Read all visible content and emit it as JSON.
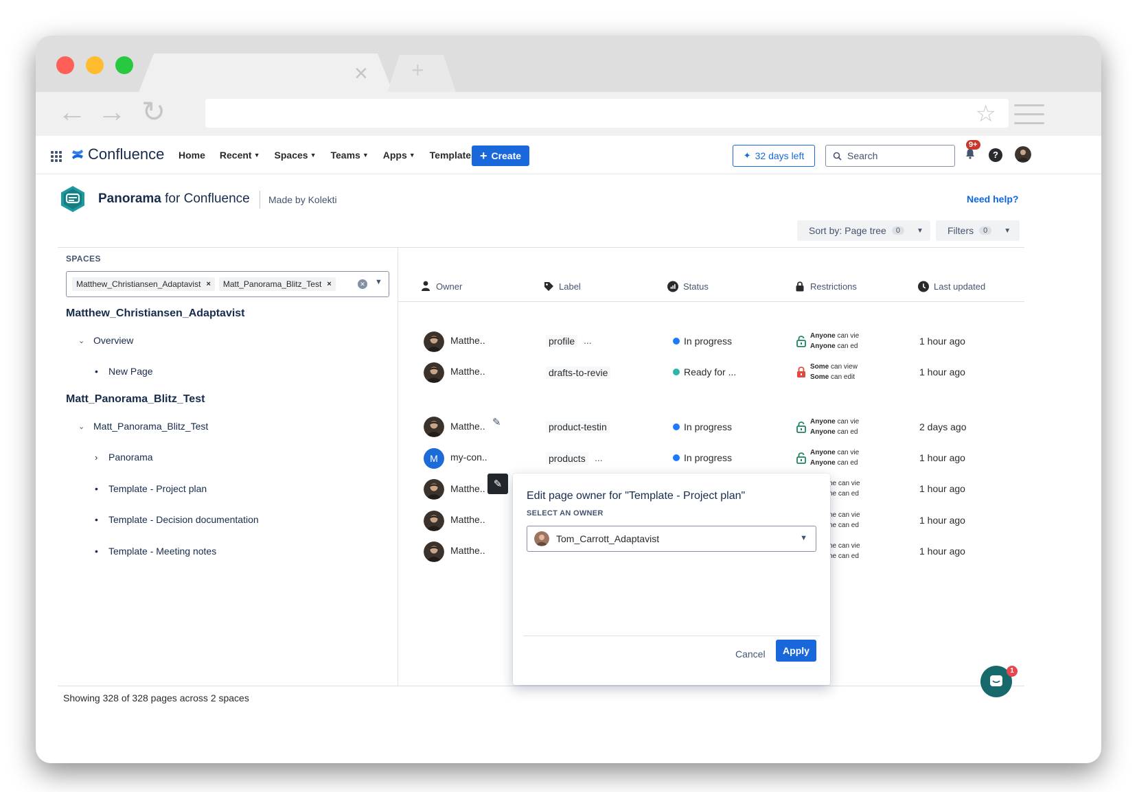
{
  "browser": {
    "tab_close": "×",
    "new_tab": "+",
    "back": "←",
    "forward": "→",
    "reload": "↻",
    "bookmark": "☆"
  },
  "topbar": {
    "product": "Confluence",
    "nav": [
      {
        "label": "Home",
        "has_dropdown": false
      },
      {
        "label": "Recent",
        "has_dropdown": true
      },
      {
        "label": "Spaces",
        "has_dropdown": true
      },
      {
        "label": "Teams",
        "has_dropdown": true
      },
      {
        "label": "Apps",
        "has_dropdown": true
      },
      {
        "label": "Templates",
        "has_dropdown": false
      }
    ],
    "create_label": "Create",
    "trial_label": "32 days left",
    "search_placeholder": "Search",
    "notifications_badge": "9+",
    "help_glyph": "?",
    "accent": "#1868db"
  },
  "app": {
    "name_bold": "Panorama",
    "name_rest": " for Confluence",
    "made_by": "Made by Kolekti",
    "need_help": "Need help?",
    "sort_label": "Sort by: Page tree",
    "sort_count": "0",
    "filters_label": "Filters",
    "filters_count": "0"
  },
  "spaces_panel": {
    "heading": "SPACES",
    "selected": [
      "Matthew_Christiansen_Adaptavist",
      "Matt_Panorama_Blitz_Test"
    ],
    "spaces": [
      {
        "name": "Matthew_Christiansen_Adaptavist",
        "items": [
          {
            "label": "Overview",
            "marker": "expanded"
          },
          {
            "label": "New Page",
            "marker": "bullet"
          }
        ]
      },
      {
        "name": "Matt_Panorama_Blitz_Test",
        "items": [
          {
            "label": "Matt_Panorama_Blitz_Test",
            "marker": "expanded"
          },
          {
            "label": "Panorama",
            "marker": "collapsed"
          },
          {
            "label": "Template - Project plan",
            "marker": "bullet"
          },
          {
            "label": "Template - Decision documentation",
            "marker": "bullet"
          },
          {
            "label": "Template - Meeting notes",
            "marker": "bullet"
          }
        ]
      }
    ],
    "footer": "Showing 328 of 328 pages across 2 spaces"
  },
  "table": {
    "columns": [
      "Owner",
      "Label",
      "Status",
      "Restrictions",
      "Last updated"
    ],
    "rows": [
      {
        "owner": "Matthe..",
        "label": "profile",
        "label_more": "...",
        "status": "In progress",
        "status_color": "#1d7afc",
        "restr_who1": "Anyone",
        "restr_rest1": " can vie",
        "restr_who2": "Anyone",
        "restr_rest2": " can ed",
        "locked": false,
        "updated": "1 hour ago"
      },
      {
        "owner": "Matthe..",
        "label": "drafts-to-revie",
        "label_more": "",
        "status": "Ready for ...",
        "status_color": "#2ab7a9",
        "restr_who1": "Some",
        "restr_rest1": " can view",
        "restr_who2": "Some",
        "restr_rest2": " can edit",
        "locked": true,
        "updated": "1 hour ago"
      },
      {
        "owner": "Matthe..",
        "label": "product-testin",
        "label_more": "",
        "status": "In progress",
        "status_color": "#1d7afc",
        "restr_who1": "Anyone",
        "restr_rest1": " can vie",
        "restr_who2": "Anyone",
        "restr_rest2": " can ed",
        "locked": false,
        "updated": "2 days ago"
      },
      {
        "owner": "my-con..",
        "label": "products",
        "label_more": "...",
        "status": "In progress",
        "status_color": "#1d7afc",
        "restr_who1": "Anyone",
        "restr_rest1": " can vie",
        "restr_who2": "Anyone",
        "restr_rest2": " can ed",
        "locked": false,
        "updated": "1 hour ago"
      },
      {
        "owner": "Matthe..",
        "restr_line1": "ne can vie",
        "restr_line2": "ne can ed",
        "updated": "1 hour ago"
      },
      {
        "owner": "Matthe..",
        "restr_line1": "ne can vie",
        "restr_line2": "ne can ed",
        "updated": "1 hour ago"
      },
      {
        "owner": "Matthe..",
        "restr_line1": "ne can vie",
        "restr_line2": "ne can ed",
        "updated": "1 hour ago"
      }
    ],
    "initial_avatar": "M"
  },
  "dialog": {
    "title": "Edit page owner for \"Template - Project plan\"",
    "select_label": "SELECT AN OWNER",
    "selected_owner": "Tom_Carrott_Adaptavist",
    "cancel_label": "Cancel",
    "apply_label": "Apply"
  },
  "chat": {
    "badge": "1"
  }
}
